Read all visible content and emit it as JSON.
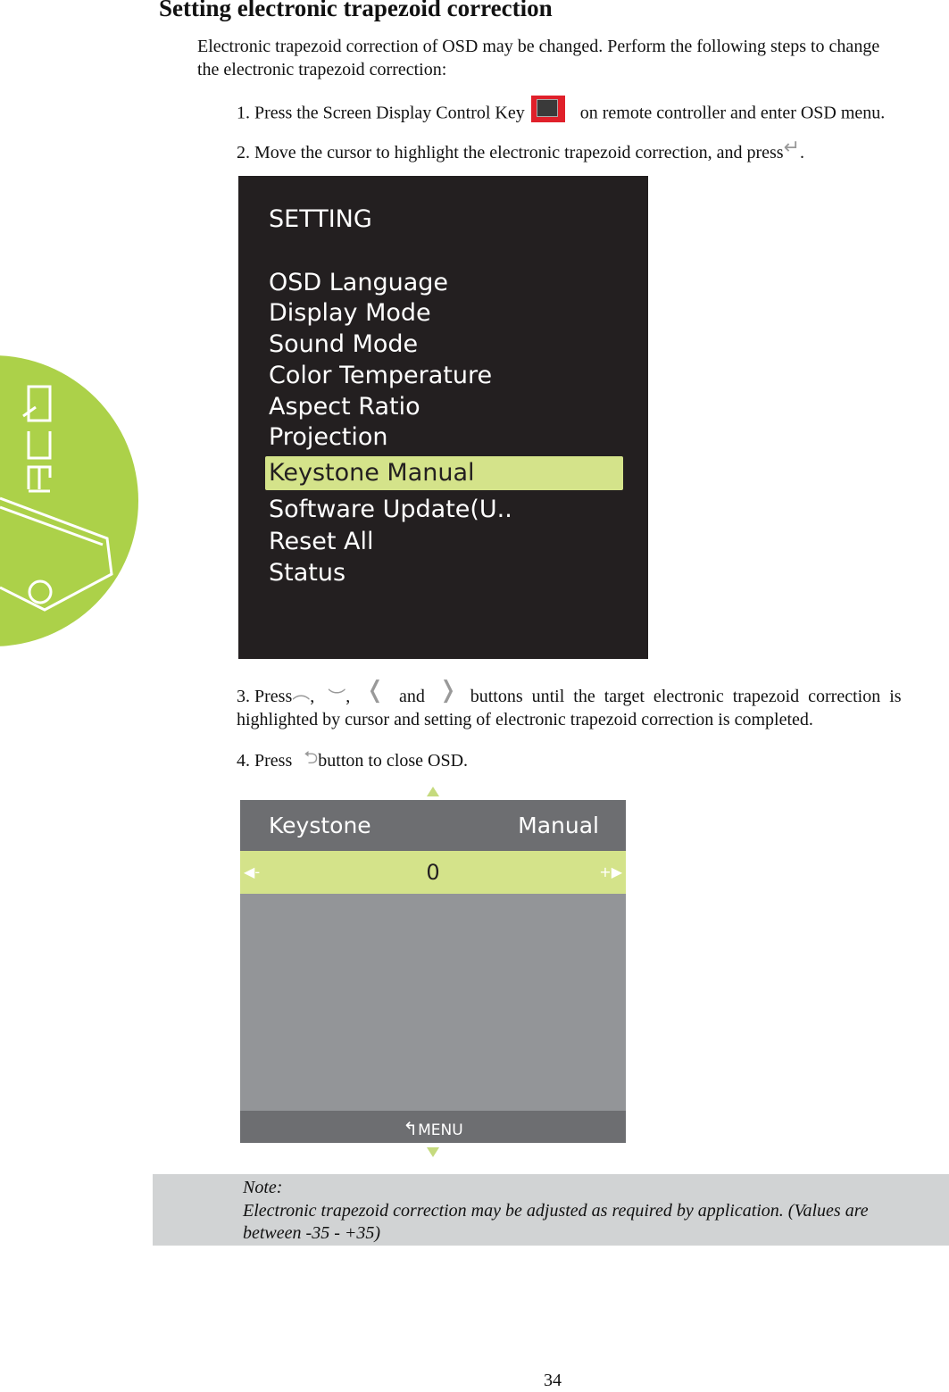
{
  "heading": "Setting electronic trapezoid correction",
  "intro": [
    "Electronic trapezoid correction of OSD may be changed. Perform the following steps to change",
    "the electronic trapezoid correction:"
  ],
  "steps": {
    "s1a": "1. Press the Screen Display Control Key",
    "s1b": "on remote controller and enter OSD menu.",
    "s2a": "2. Move the cursor to highlight the electronic trapezoid correction, and press",
    "s2b": ".",
    "s3a": "3. Press",
    "s3comma": ",",
    "s3and": "and",
    "s3b": "buttons until the target electronic trapezoid correction is",
    "s3c": "highlighted by cursor and setting of electronic trapezoid correction is completed.",
    "s4a": "4. Press",
    "s4b": "button to close OSD."
  },
  "setting_menu": {
    "title": "SETTING",
    "items": [
      "OSD Language",
      "Display Mode",
      "Sound Mode",
      "Color Temperature",
      "Aspect Ratio",
      "Projection",
      "Keystone Manual",
      "Software Update(U..",
      "Reset All",
      "Status"
    ],
    "selected": "Keystone Manual",
    "highlight_color": "#d4e38a"
  },
  "keystone_panel": {
    "label": "Keystone",
    "mode": "Manual",
    "value": "0",
    "minus": "-",
    "plus": "+",
    "footer": "MENU"
  },
  "note": {
    "title": "Note:",
    "lines": [
      "Electronic trapezoid correction may be adjusted as required by application. (Values are",
      "between -35 - +35)"
    ]
  },
  "logo": {
    "text": "QUMI",
    "color": "#acd149"
  },
  "page_number": "34"
}
